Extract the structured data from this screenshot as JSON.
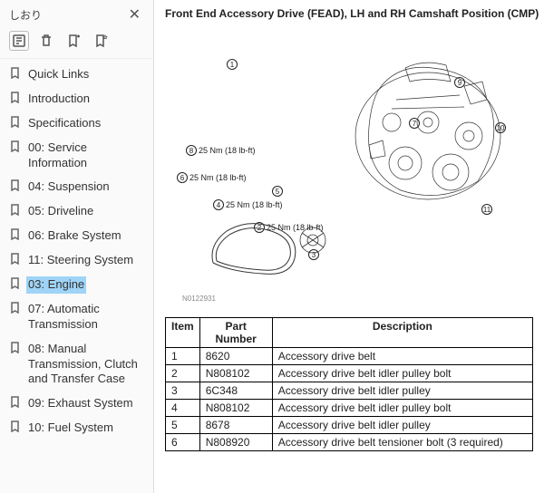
{
  "sidebar": {
    "title": "しおり",
    "items": [
      {
        "label": "Quick Links",
        "selected": false
      },
      {
        "label": "Introduction",
        "selected": false
      },
      {
        "label": "Specifications",
        "selected": false
      },
      {
        "label": "00: Service Information",
        "selected": false
      },
      {
        "label": "04: Suspension",
        "selected": false
      },
      {
        "label": "05: Driveline",
        "selected": false
      },
      {
        "label": "06: Brake System",
        "selected": false
      },
      {
        "label": "11: Steering System",
        "selected": false
      },
      {
        "label": "03: Engine",
        "selected": true
      },
      {
        "label": "07: Automatic Transmission",
        "selected": false
      },
      {
        "label": "08: Manual Transmission, Clutch and Transfer Case",
        "selected": false
      },
      {
        "label": "09: Exhaust System",
        "selected": false
      },
      {
        "label": "10: Fuel System",
        "selected": false
      }
    ]
  },
  "document": {
    "heading": "Front End Accessory Drive (FEAD), LH and RH Camshaft Position (CMP)",
    "figure_id": "N0122931",
    "callouts": [
      {
        "num": "8",
        "text": "25 Nm (18 lb-ft)"
      },
      {
        "num": "6",
        "text": "25 Nm (18 lb-ft)"
      },
      {
        "num": "4",
        "text": "25 Nm (18 lb-ft)"
      },
      {
        "num": "2",
        "text": "25 Nm (18 lb-ft)"
      }
    ],
    "extra_callouts": [
      "1",
      "7",
      "9",
      "10",
      "11",
      "3",
      "5"
    ],
    "table": {
      "headers": [
        "Item",
        "Part Number",
        "Description"
      ],
      "rows": [
        {
          "item": "1",
          "part": "8620",
          "desc": "Accessory drive belt"
        },
        {
          "item": "2",
          "part": "N808102",
          "desc": "Accessory drive belt idler pulley bolt"
        },
        {
          "item": "3",
          "part": "6C348",
          "desc": "Accessory drive belt idler pulley"
        },
        {
          "item": "4",
          "part": "N808102",
          "desc": "Accessory drive belt idler pulley bolt"
        },
        {
          "item": "5",
          "part": "8678",
          "desc": "Accessory drive belt idler pulley"
        },
        {
          "item": "6",
          "part": "N808920",
          "desc": "Accessory drive belt tensioner bolt (3 required)"
        }
      ]
    }
  }
}
